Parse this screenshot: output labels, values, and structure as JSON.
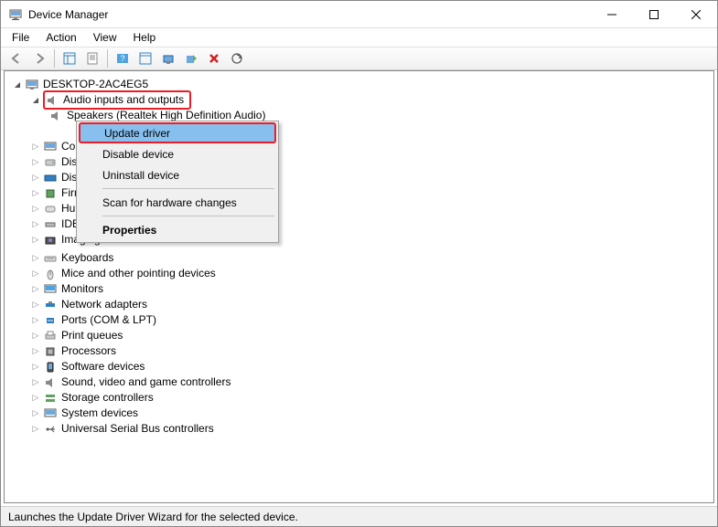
{
  "title": "Device Manager",
  "menus": [
    "File",
    "Action",
    "View",
    "Help"
  ],
  "root": "DESKTOP-2AC4EG5",
  "audioCategory": "Audio inputs and outputs",
  "audioChildren": [
    "Speakers (Realtek High Definition Audio)"
  ],
  "hiddenItemSuffix": ")",
  "categories": [
    "Computer",
    "Disk drives",
    "Display adapters",
    "Firmware",
    "Human Interface Devices",
    "IDE ATA/ATAPI controllers",
    "Imaging devices",
    "Keyboards",
    "Mice and other pointing devices",
    "Monitors",
    "Network adapters",
    "Ports (COM & LPT)",
    "Print queues",
    "Processors",
    "Software devices",
    "Sound, video and game controllers",
    "Storage controllers",
    "System devices",
    "Universal Serial Bus controllers"
  ],
  "contextMenu": {
    "update": "Update driver",
    "disable": "Disable device",
    "uninstall": "Uninstall device",
    "scan": "Scan for hardware changes",
    "properties": "Properties"
  },
  "status": "Launches the Update Driver Wizard for the selected device."
}
